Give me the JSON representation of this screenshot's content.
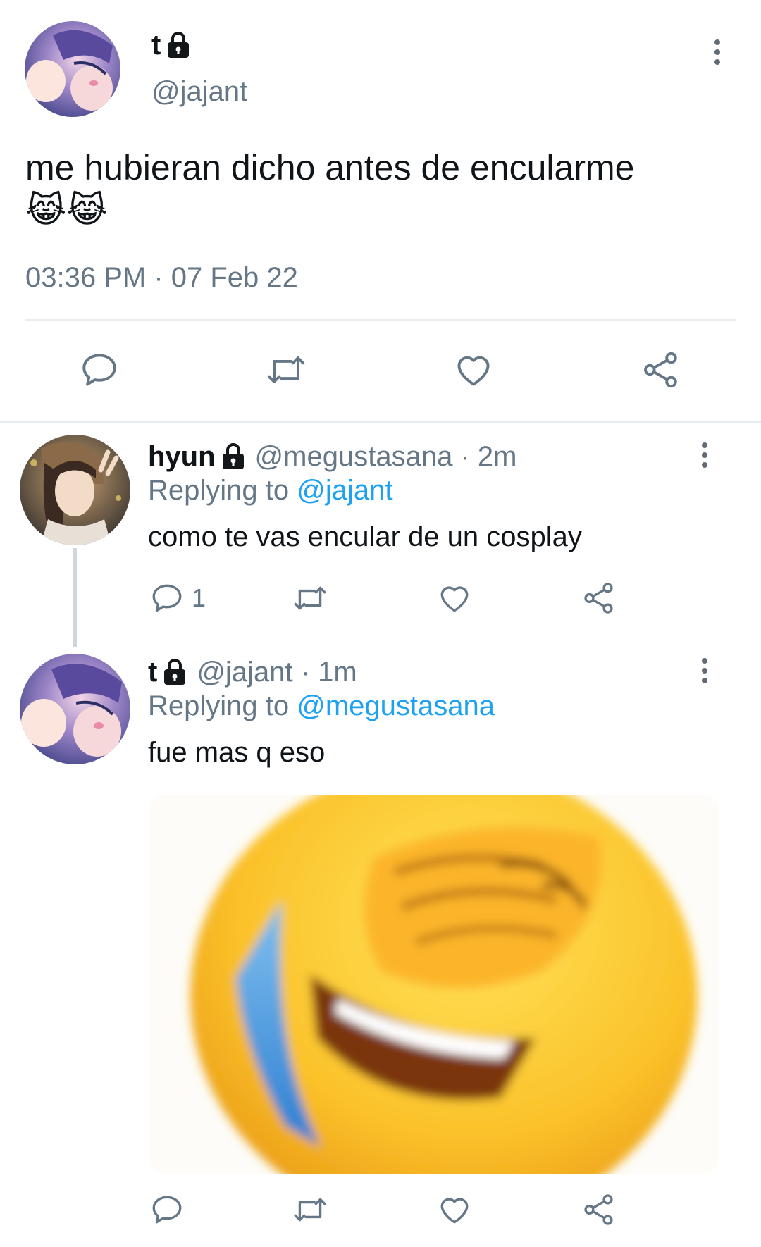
{
  "main_tweet": {
    "display_name": "t",
    "handle": "@jajant",
    "text": "me hubieran dicho antes de encularme",
    "emoji": "😹😹",
    "timestamp": "03:36 PM · 07 Feb 22"
  },
  "replies": [
    {
      "display_name": "hyun",
      "handle_time": "@megustasana · 2m",
      "replying_prefix": "Replying to",
      "replying_to": "@jajant",
      "text": "como te vas encular de un cosplay",
      "reply_count": "1"
    },
    {
      "display_name": "t",
      "handle_time": "@jajant · 1m",
      "replying_prefix": "Replying to",
      "replying_to": "@megustasana",
      "text": "fue mas q eso"
    }
  ],
  "icons": {
    "reply": "speech-bubble-icon",
    "retweet": "retweet-icon",
    "like": "heart-icon",
    "share": "share-nodes-icon",
    "more": "vertical-dots-icon",
    "lock": "lock-icon"
  },
  "colors": {
    "link": "#1da1f2",
    "muted": "#657786",
    "icon": "#657786",
    "divider": "#e6ecf0"
  }
}
